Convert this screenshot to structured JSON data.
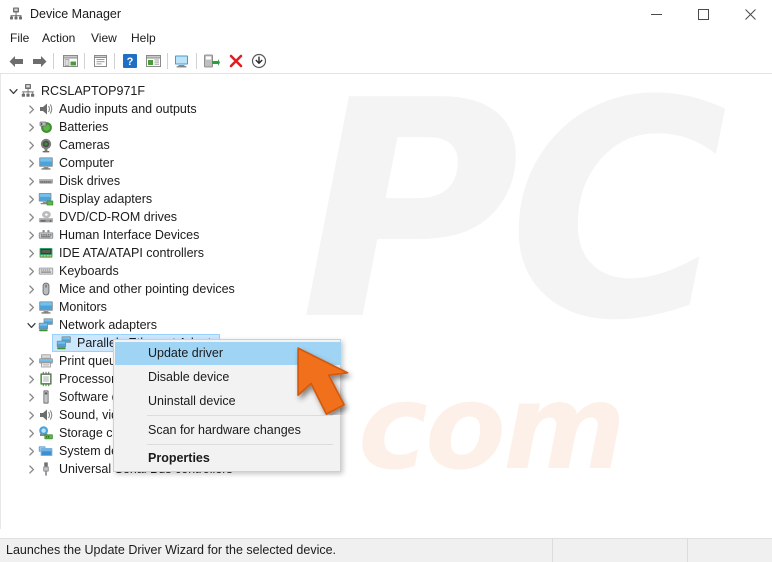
{
  "window": {
    "title": "Device Manager",
    "icon": "device-manager-icon",
    "controls": {
      "minimize": "─",
      "maximize": "□",
      "close": "✕"
    }
  },
  "menubar": {
    "items": [
      {
        "label": "File",
        "name": "menu-file"
      },
      {
        "label": "Action",
        "name": "menu-action"
      },
      {
        "label": "View",
        "name": "menu-view"
      },
      {
        "label": "Help",
        "name": "menu-help"
      }
    ]
  },
  "toolbar": {
    "buttons": [
      {
        "name": "back-icon",
        "title": "Back"
      },
      {
        "name": "forward-icon",
        "title": "Forward"
      },
      {
        "name": "show-hide-console-tree-icon",
        "title": "Show/Hide Console Tree"
      },
      {
        "name": "properties-icon",
        "title": "Properties"
      },
      {
        "name": "help-icon",
        "title": "Help"
      },
      {
        "name": "show-hide-action-pane-icon",
        "title": "Show/Hide Action Pane"
      },
      {
        "name": "update-driver-icon",
        "title": "Update Driver"
      },
      {
        "name": "scan-for-hardware-changes-icon",
        "title": "Scan for hardware changes"
      },
      {
        "name": "disable-device-icon",
        "title": "Disable device"
      },
      {
        "name": "uninstall-device-icon",
        "title": "Uninstall device"
      },
      {
        "name": "enable-device-icon",
        "title": "Enable device"
      }
    ]
  },
  "tree": {
    "root": {
      "label": "RCSLAPTOP971F",
      "icon": "computer-root-icon",
      "expanded": true
    },
    "items": [
      {
        "label": "Audio inputs and outputs",
        "icon": "speaker-icon",
        "expanded": false,
        "indent": 1
      },
      {
        "label": "Batteries",
        "icon": "battery-icon",
        "expanded": false,
        "indent": 1
      },
      {
        "label": "Cameras",
        "icon": "camera-icon",
        "expanded": false,
        "indent": 1
      },
      {
        "label": "Computer",
        "icon": "monitor-icon",
        "expanded": false,
        "indent": 1
      },
      {
        "label": "Disk drives",
        "icon": "disk-drive-icon",
        "expanded": false,
        "indent": 1
      },
      {
        "label": "Display adapters",
        "icon": "display-adapter-icon",
        "expanded": false,
        "indent": 1
      },
      {
        "label": "DVD/CD-ROM drives",
        "icon": "optical-drive-icon",
        "expanded": false,
        "indent": 1
      },
      {
        "label": "Human Interface Devices",
        "icon": "hid-icon",
        "expanded": false,
        "indent": 1
      },
      {
        "label": "IDE ATA/ATAPI controllers",
        "icon": "ide-controller-icon",
        "expanded": false,
        "indent": 1
      },
      {
        "label": "Keyboards",
        "icon": "keyboard-icon",
        "expanded": false,
        "indent": 1
      },
      {
        "label": "Mice and other pointing devices",
        "icon": "mouse-icon",
        "expanded": false,
        "indent": 1
      },
      {
        "label": "Monitors",
        "icon": "monitor-icon",
        "expanded": false,
        "indent": 1
      },
      {
        "label": "Network adapters",
        "icon": "network-adapter-icon",
        "expanded": true,
        "indent": 1
      },
      {
        "label": "Parallels Ethernet Adapter",
        "icon": "network-adapter-icon",
        "expanded": false,
        "indent": 2,
        "selected": true
      },
      {
        "label": "Print queues",
        "icon": "printer-icon",
        "expanded": false,
        "indent": 1
      },
      {
        "label": "Processors",
        "icon": "processor-icon",
        "expanded": false,
        "indent": 1
      },
      {
        "label": "Software devices",
        "icon": "software-device-icon",
        "expanded": false,
        "indent": 1
      },
      {
        "label": "Sound, video and game controllers",
        "icon": "speaker-icon",
        "expanded": false,
        "indent": 1
      },
      {
        "label": "Storage controllers",
        "icon": "storage-controller-icon",
        "expanded": false,
        "indent": 1
      },
      {
        "label": "System devices",
        "icon": "system-device-icon",
        "expanded": false,
        "indent": 1
      },
      {
        "label": "Universal Serial Bus controllers",
        "icon": "usb-icon",
        "expanded": false,
        "indent": 1
      }
    ]
  },
  "context_menu": {
    "items": [
      {
        "label": "Update driver",
        "highlighted": true,
        "bold": false
      },
      {
        "label": "Disable device",
        "highlighted": false,
        "bold": false
      },
      {
        "label": "Uninstall device",
        "highlighted": false,
        "bold": false
      },
      {
        "label": "Scan for hardware changes",
        "highlighted": false,
        "bold": false
      },
      {
        "label": "Properties",
        "highlighted": false,
        "bold": true
      }
    ]
  },
  "status_bar": {
    "message": "Launches the Update Driver Wizard for the selected device."
  },
  "colors": {
    "selection_fill": "#cce8ff",
    "selection_border": "#99d1ff",
    "menu_highlight": "#9fd4f5",
    "cursor_orange": "#f0701e",
    "window_bg": "#ffffff",
    "status_bg": "#f0f0f0"
  }
}
